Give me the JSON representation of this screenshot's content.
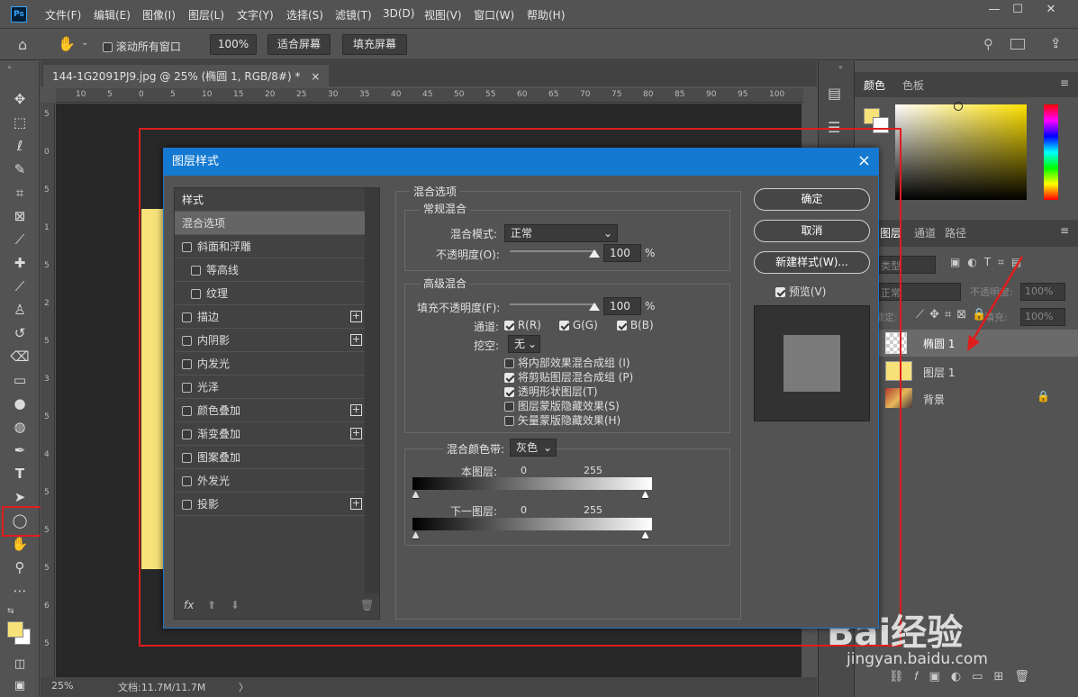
{
  "app": {
    "logo": "Ps"
  },
  "menu": [
    "文件(F)",
    "编辑(E)",
    "图像(I)",
    "图层(L)",
    "文字(Y)",
    "选择(S)",
    "滤镜(T)",
    "3D(D)",
    "视图(V)",
    "窗口(W)",
    "帮助(H)"
  ],
  "options": {
    "scroll_all": "滚动所有窗口",
    "zoom": "100%",
    "fit_screen": "适合屏幕",
    "fill_screen": "填充屏幕"
  },
  "document": {
    "tab_title": "144-1G2091PJ9.jpg @ 25% (椭圆 1, RGB/8#) *",
    "close": "×"
  },
  "ruler_h": [
    "10",
    "5",
    "0",
    "5",
    "10",
    "15",
    "20",
    "25",
    "30",
    "35",
    "40",
    "45",
    "50",
    "55",
    "60",
    "65",
    "70",
    "75",
    "80",
    "85",
    "90",
    "95",
    "100"
  ],
  "ruler_v": [
    "5",
    "0",
    "5",
    "1",
    "5",
    "2",
    "5",
    "3",
    "5",
    "4",
    "5",
    "5",
    "5",
    "6",
    "5"
  ],
  "status": {
    "zoom": "25%",
    "doc": "文档:11.7M/11.7M",
    "arrow": "〉"
  },
  "color_panel": {
    "tabs": [
      "颜色",
      "色板"
    ],
    "fg_color": "#f7e27a"
  },
  "layers_panel": {
    "tabs": [
      "图层",
      "通道",
      "路径"
    ],
    "kind": "类型",
    "blend": "正常",
    "opacity_label": "不透明度:",
    "opacity": "100%",
    "lock_label": "锁定:",
    "fill_label": "填充:",
    "fill": "100%",
    "layers": [
      {
        "name": "椭圆 1"
      },
      {
        "name": "图层 1"
      },
      {
        "name": "背景"
      }
    ]
  },
  "watermark": {
    "brand": "Bai经验",
    "url": "jingyan.baidu.com"
  },
  "dialog": {
    "title": "图层样式",
    "close": "×",
    "styles_header": "样式",
    "styles": [
      {
        "label": "混合选项",
        "checkbox": false,
        "plus": false,
        "indent": 0,
        "selected": true
      },
      {
        "label": "斜面和浮雕",
        "checkbox": true,
        "plus": false,
        "indent": 0
      },
      {
        "label": "等高线",
        "checkbox": true,
        "plus": false,
        "indent": 1
      },
      {
        "label": "纹理",
        "checkbox": true,
        "plus": false,
        "indent": 1
      },
      {
        "label": "描边",
        "checkbox": true,
        "plus": true,
        "indent": 0
      },
      {
        "label": "内阴影",
        "checkbox": true,
        "plus": true,
        "indent": 0
      },
      {
        "label": "内发光",
        "checkbox": true,
        "plus": false,
        "indent": 0
      },
      {
        "label": "光泽",
        "checkbox": true,
        "plus": false,
        "indent": 0
      },
      {
        "label": "颜色叠加",
        "checkbox": true,
        "plus": true,
        "indent": 0
      },
      {
        "label": "渐变叠加",
        "checkbox": true,
        "plus": true,
        "indent": 0
      },
      {
        "label": "图案叠加",
        "checkbox": true,
        "plus": false,
        "indent": 0
      },
      {
        "label": "外发光",
        "checkbox": true,
        "plus": false,
        "indent": 0
      },
      {
        "label": "投影",
        "checkbox": true,
        "plus": true,
        "indent": 0
      }
    ],
    "fx": "fx",
    "blend_options": "混合选项",
    "general": "常规混合",
    "blend_mode_label": "混合模式:",
    "blend_mode": "正常",
    "opacity_label": "不透明度(O):",
    "opacity": "100",
    "percent": "%",
    "advanced": "高级混合",
    "fill_opacity_label": "填充不透明度(F):",
    "fill_opacity": "100",
    "channels_label": "通道:",
    "channel_r": "R(R)",
    "channel_g": "G(G)",
    "channel_b": "B(B)",
    "knockout_label": "挖空:",
    "knockout": "无",
    "opt1": "将内部效果混合成组 (I)",
    "opt2": "将剪贴图层混合成组 (P)",
    "opt3": "透明形状图层(T)",
    "opt4": "图层蒙版隐藏效果(S)",
    "opt5": "矢量蒙版隐藏效果(H)",
    "blend_if_label": "混合颜色带:",
    "blend_if": "灰色",
    "this_layer": "本图层:",
    "underlying": "下一图层:",
    "zero": "0",
    "max": "255",
    "ok": "确定",
    "cancel": "取消",
    "new_style": "新建样式(W)...",
    "preview": "预览(V)"
  }
}
